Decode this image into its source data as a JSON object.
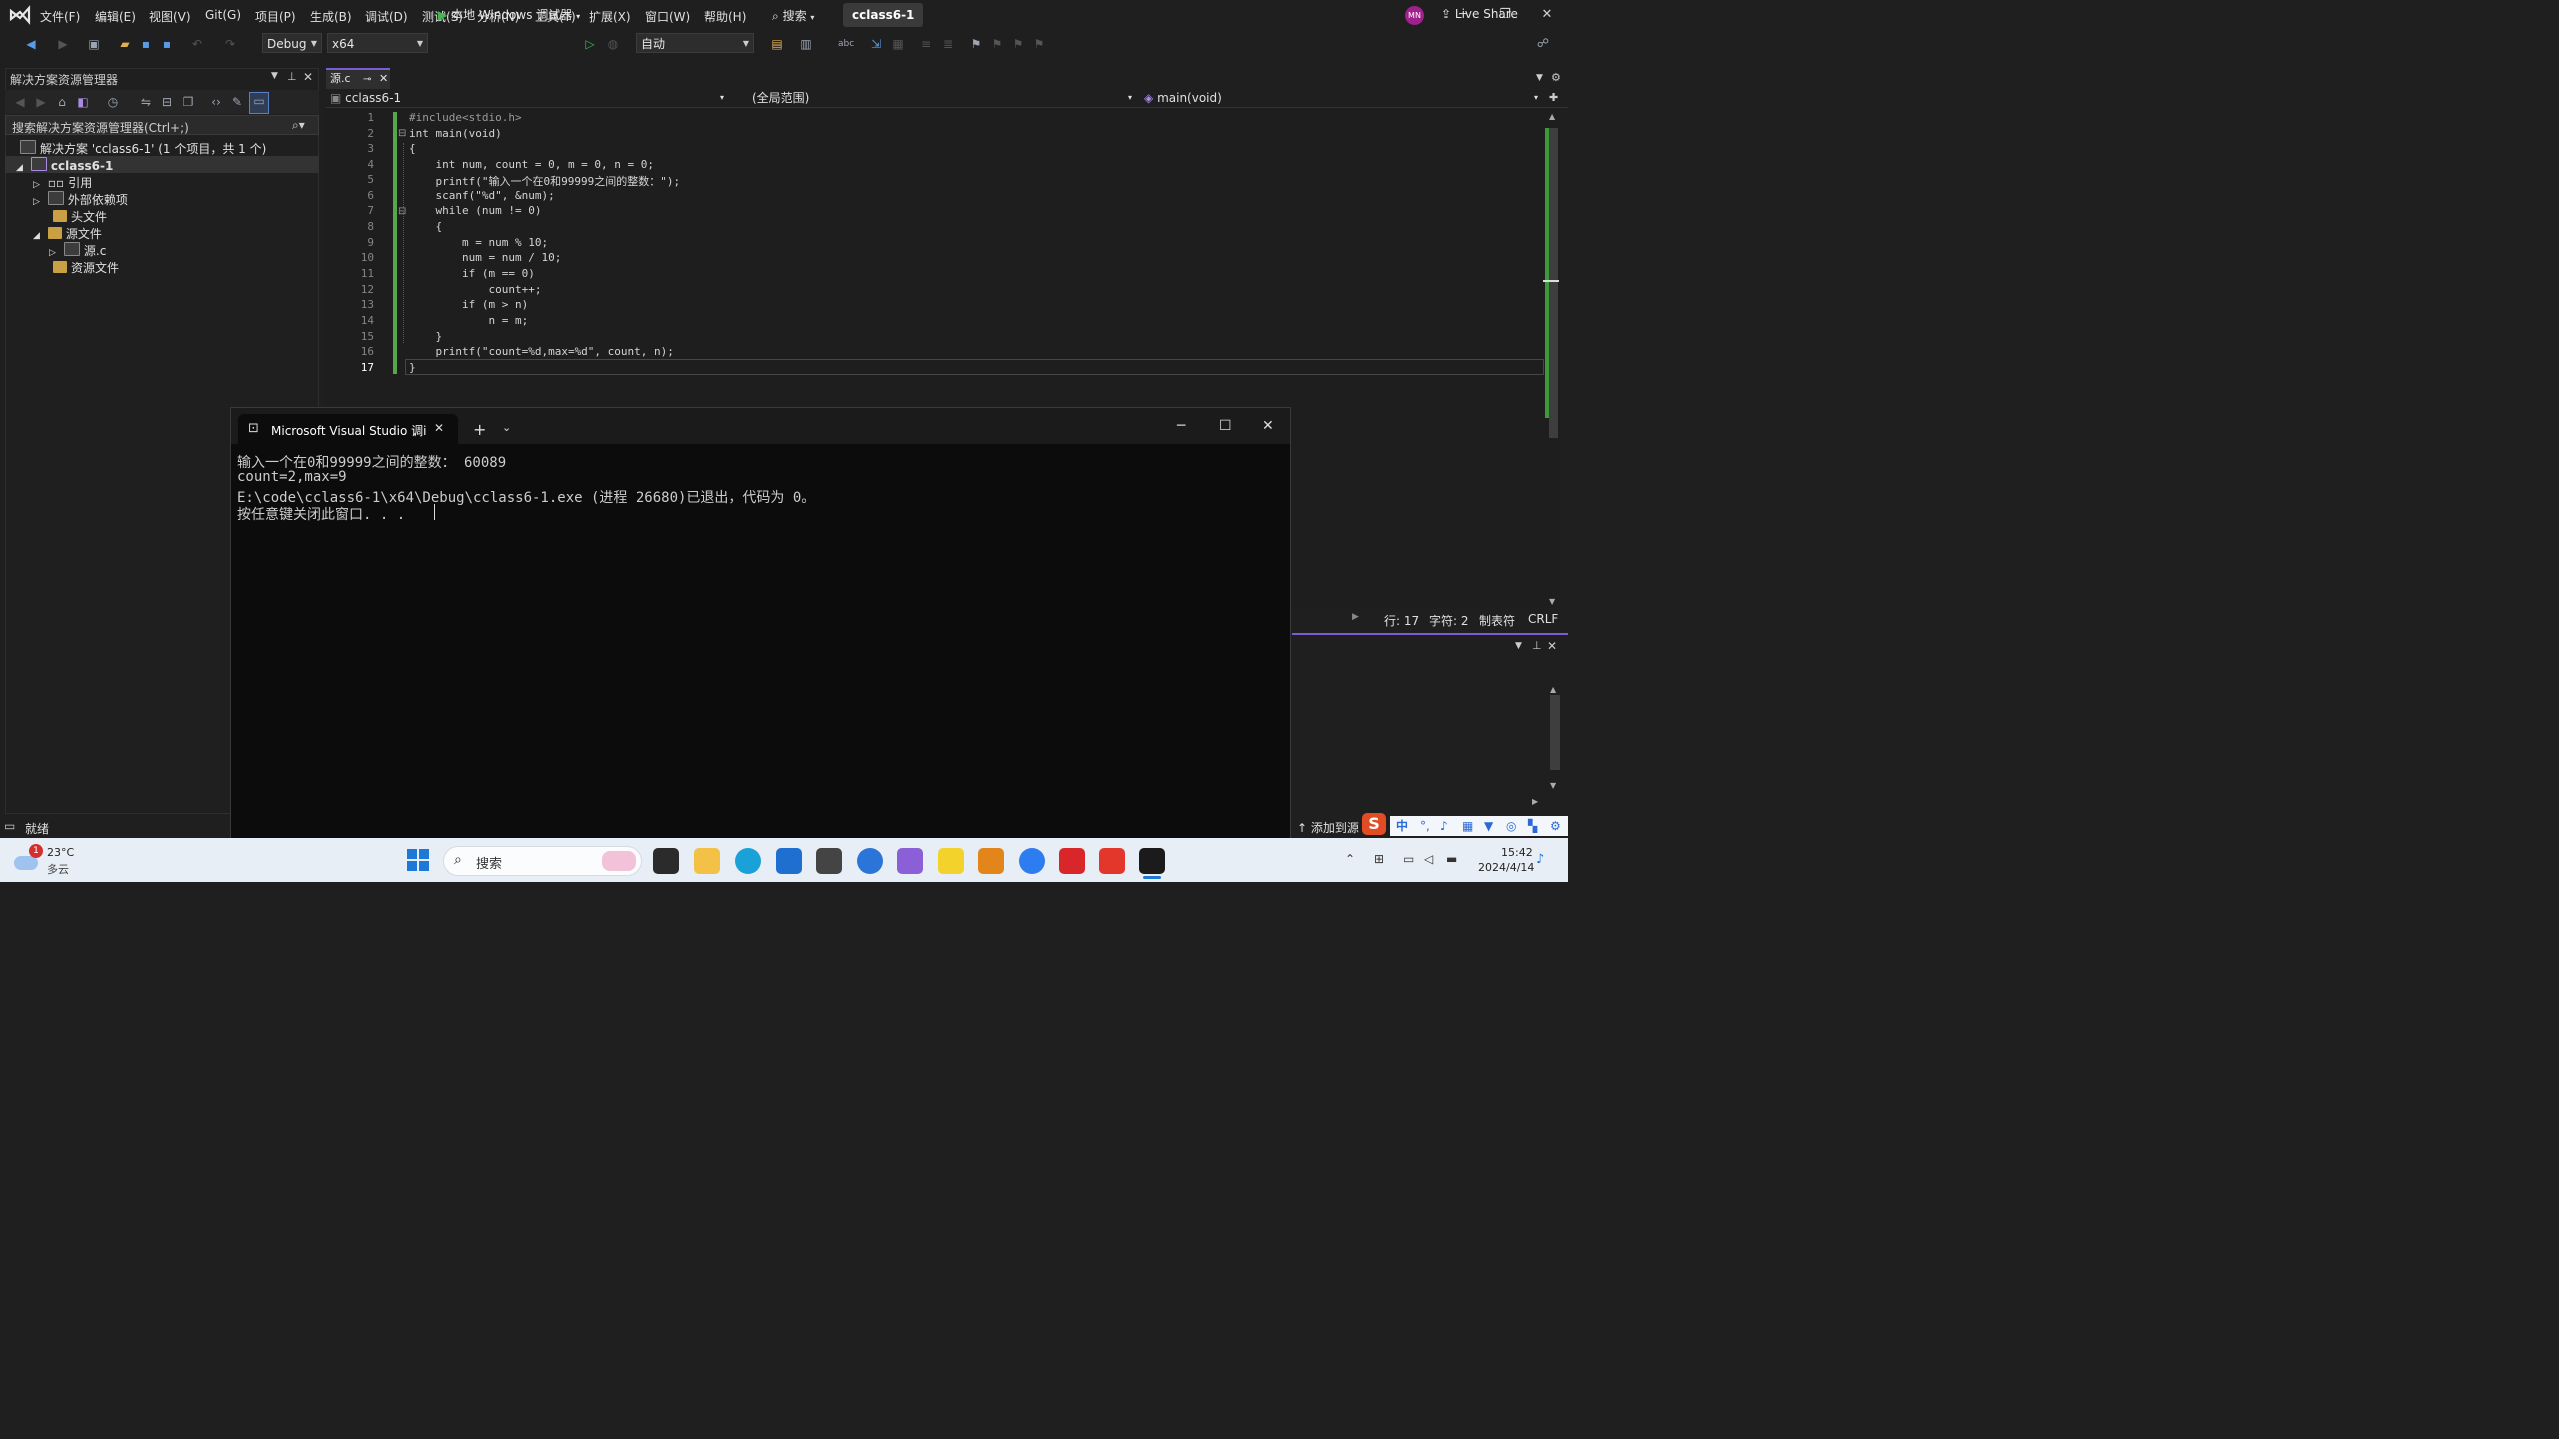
{
  "menubar": {
    "items": [
      "文件(F)",
      "编辑(E)",
      "视图(V)",
      "Git(G)",
      "项目(P)",
      "生成(B)",
      "调试(D)",
      "测试(S)",
      "分析(N)",
      "工具(T)",
      "扩展(X)",
      "窗口(W)",
      "帮助(H)"
    ],
    "search": "搜索",
    "title": "cclass6-1",
    "avatar": "MN"
  },
  "toolbar": {
    "config": "Debug",
    "platform": "x64",
    "run_label": "本地 Windows 调试器",
    "auto": "自动",
    "live_share": "Live Share"
  },
  "solution_explorer": {
    "title": "解决方案资源管理器",
    "search_placeholder": "搜索解决方案资源管理器(Ctrl+;)",
    "solution": "解决方案 'cclass6-1' (1 个项目，共 1 个)",
    "project": "cclass6-1",
    "items": [
      "引用",
      "外部依赖项",
      "头文件",
      "源文件",
      "源.c",
      "资源文件"
    ]
  },
  "editor": {
    "tab": "源.c",
    "nav_project": "cclass6-1",
    "nav_scope": "(全局范围)",
    "nav_func": "main(void)",
    "lines": [
      "#include<stdio.h>",
      "int main(void)",
      "{",
      "    int num, count = 0, m = 0, n = 0;",
      "    printf(\"输入一个在0和99999之间的整数：\");",
      "    scanf(\"%d\", &num);",
      "    while (num != 0)",
      "    {",
      "        m = num % 10;",
      "        num = num / 10;",
      "        if (m == 0)",
      "            count++;",
      "        if (m > n)",
      "            n = m;",
      "    }",
      "    printf(\"count=%d,max=%d\", count, n);",
      "}"
    ],
    "line_numbers": [
      "1",
      "2",
      "3",
      "4",
      "5",
      "6",
      "7",
      "8",
      "9",
      "10",
      "11",
      "12",
      "13",
      "14",
      "15",
      "16",
      "17"
    ]
  },
  "status_line": {
    "row": "行: 17",
    "col": "字符: 2",
    "tab": "制表符",
    "eol": "CRLF"
  },
  "console": {
    "tab_title": "Microsoft Visual Studio 调i",
    "lines": [
      "输入一个在0和99999之间的整数： 60089",
      "count=2,max=9",
      "E:\\code\\cclass6-1\\x64\\Debug\\cclass6-1.exe (进程 26680)已退出，代码为 0。",
      "按任意键关闭此窗口. . ."
    ]
  },
  "statusbar": {
    "ready": "就绪",
    "add_source": "添加到源"
  },
  "taskbar": {
    "weather_temp": "23°C",
    "weather_desc": "多云",
    "weather_badge": "1",
    "search": "搜索",
    "time": "15:42",
    "date": "2024/4/14",
    "ime": "中"
  }
}
